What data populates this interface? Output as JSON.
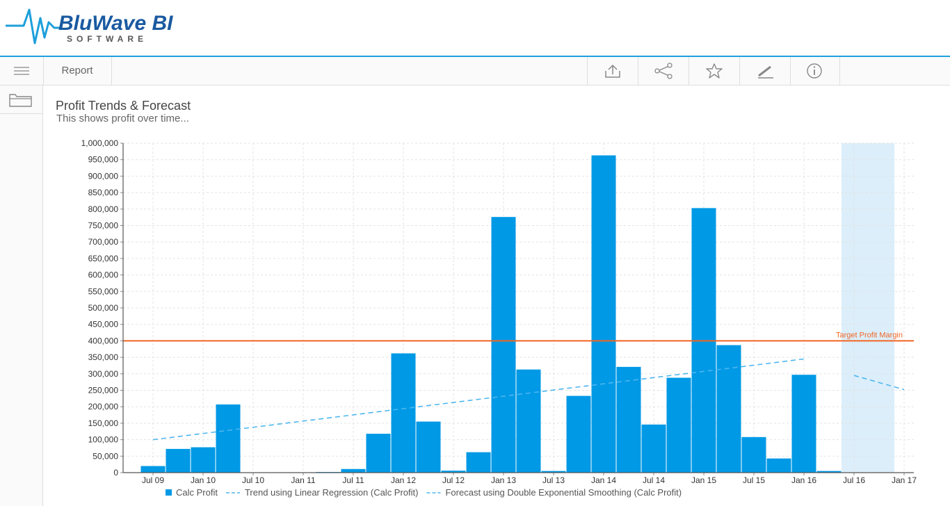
{
  "brand": {
    "name": "BluWave BI",
    "tagline": "SOFTWARE",
    "color": "#1e9fdb",
    "dark_color": "#1a5aa0"
  },
  "toolbar": {
    "report_label": "Report",
    "icons": [
      "export-icon",
      "share-icon",
      "favorite-star-icon",
      "annotate-pencil-icon",
      "info-icon"
    ]
  },
  "sidebar": {
    "icons": [
      "menu-icon",
      "folder-icon"
    ]
  },
  "chart": {
    "title": "Profit Trends & Forecast",
    "subtitle": "This shows profit over time..."
  },
  "chart_data": {
    "type": "bar",
    "title": "Profit Trends & Forecast",
    "subtitle": "This shows profit over time...",
    "ylim": [
      0,
      1000000
    ],
    "y_ticks": [
      0,
      50000,
      100000,
      150000,
      200000,
      250000,
      300000,
      350000,
      400000,
      450000,
      500000,
      550000,
      600000,
      650000,
      700000,
      750000,
      800000,
      850000,
      900000,
      950000,
      1000000
    ],
    "y_tick_labels": [
      "0",
      "50,000",
      "100,000",
      "150,000",
      "200,000",
      "250,000",
      "300,000",
      "350,000",
      "400,000",
      "450,000",
      "500,000",
      "550,000",
      "600,000",
      "650,000",
      "700,000",
      "750,000",
      "800,000",
      "850,000",
      "900,000",
      "950,000",
      "1,000,000"
    ],
    "x_tick_labels": [
      "Jul 09",
      "Jan 10",
      "Jul 10",
      "Jan 11",
      "Jul 11",
      "Jan 12",
      "Jul 12",
      "Jan 13",
      "Jul 13",
      "Jan 14",
      "Jul 14",
      "Jan 15",
      "Jul 15",
      "Jan 16",
      "Jul 16",
      "Jan 17"
    ],
    "periods": [
      "Jul 09",
      "Oct 09",
      "Jan 10",
      "Apr 10",
      "Jul 10",
      "Oct 10",
      "Jan 11",
      "Apr 11",
      "Jul 11",
      "Oct 11",
      "Jan 12",
      "Apr 12",
      "Jul 12",
      "Oct 12",
      "Jan 13",
      "Apr 13",
      "Jul 13",
      "Oct 13",
      "Jan 14",
      "Apr 14",
      "Jul 14",
      "Oct 14",
      "Jan 15",
      "Apr 15",
      "Jul 15",
      "Oct 15",
      "Jan 16",
      "Apr 16",
      "Jul 16",
      "Oct 16",
      "Jan 17"
    ],
    "series": [
      {
        "name": "Calc Profit",
        "kind": "bar",
        "color": "#0099e6",
        "values": [
          20000,
          72000,
          77000,
          207000,
          0,
          0,
          0,
          2000,
          11000,
          118000,
          362000,
          155000,
          6000,
          62000,
          776000,
          313000,
          5000,
          233000,
          963000,
          321000,
          146000,
          288000,
          803000,
          387000,
          108000,
          43000,
          297000,
          5000
        ]
      },
      {
        "name": "Trend using Linear Regression (Calc Profit)",
        "kind": "dashed-line",
        "color": "#4db6ee",
        "points": [
          [
            "Jul 09",
            100000
          ],
          [
            "Jan 16",
            345000
          ]
        ]
      },
      {
        "name": "Forecast using Double Exponential Smoothing (Calc Profit)",
        "kind": "dashed-line",
        "color": "#4db6ee",
        "points": [
          [
            "Jul 16",
            295000
          ],
          [
            "Jan 17",
            252000
          ]
        ]
      }
    ],
    "target_line": {
      "label": "Target Profit Margin",
      "value": 400000,
      "color": "#f26522"
    },
    "forecast_region": {
      "from": "Jul 16",
      "to": "Jan 17",
      "color": "#dbeefa"
    },
    "grid": true,
    "legend_position": "bottom"
  }
}
